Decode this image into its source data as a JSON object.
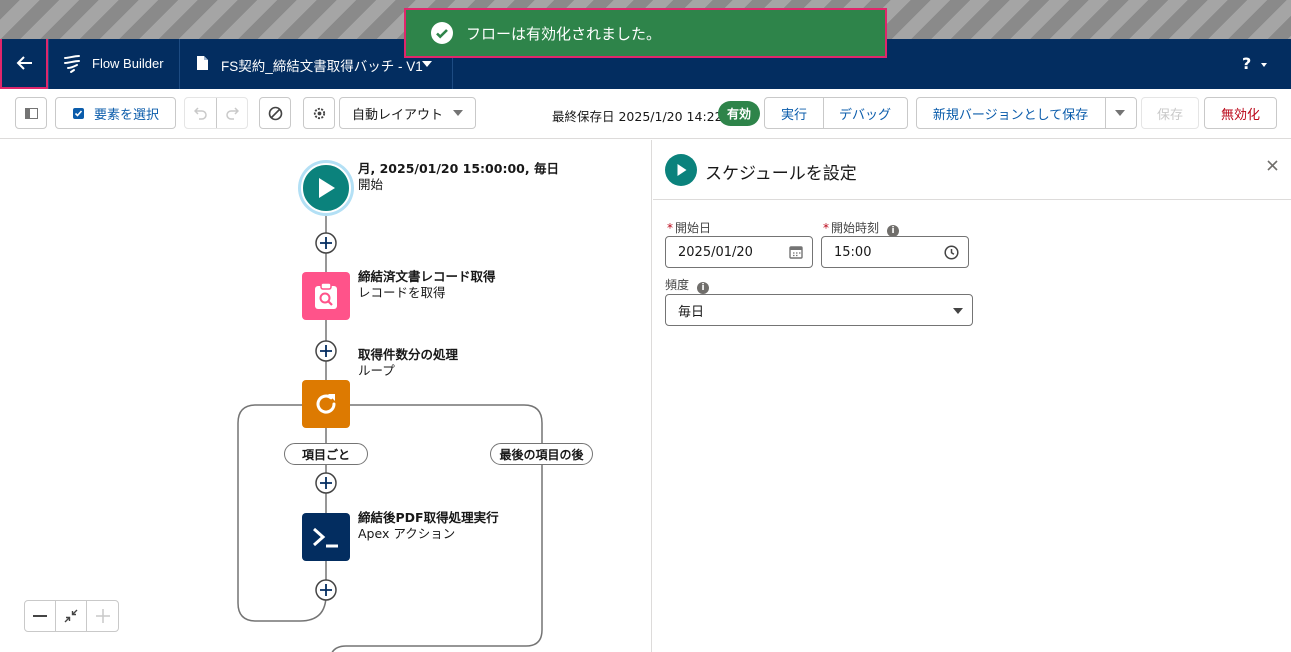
{
  "toast": {
    "message": "フローは有効化されました。"
  },
  "header": {
    "app_name": "Flow Builder",
    "flow_name": "FS契約_締結文書取得バッチ - V1",
    "help_label": "?"
  },
  "toolbar": {
    "select_elements": "要素を選択",
    "layout_mode": "自動レイアウト",
    "last_saved": "最終保存日 2025/1/20 14:22",
    "status_badge": "有効",
    "run": "実行",
    "debug": "デバッグ",
    "save_as_new_version": "新規バージョンとして保存",
    "save": "保存",
    "deactivate": "無効化"
  },
  "canvas": {
    "start": {
      "title": "月, 2025/01/20 15:00:00, 毎日",
      "subtitle": "開始"
    },
    "get_records": {
      "title": "締結済文書レコード取得",
      "subtitle": "レコードを取得"
    },
    "loop": {
      "title": "取得件数分の処理",
      "subtitle": "ループ"
    },
    "loop_each": "項目ごと",
    "loop_after": "最後の項目の後",
    "apex": {
      "title": "締結後PDF取得処理実行",
      "subtitle": "Apex アクション"
    }
  },
  "panel": {
    "title": "スケジュールを設定",
    "start_date_label": "開始日",
    "start_date_value": "2025/01/20",
    "start_time_label": "開始時刻",
    "start_time_value": "15:00",
    "frequency_label": "頻度",
    "frequency_value": "毎日"
  },
  "colors": {
    "header": "#032d60",
    "toast": "#2e844a",
    "highlight": "#e0266b",
    "start_node": "#0b827c",
    "get_records_node": "#ff538a",
    "loop_node": "#dd7a01",
    "apex_node": "#032d60",
    "brand_text": "#0b5cab"
  }
}
